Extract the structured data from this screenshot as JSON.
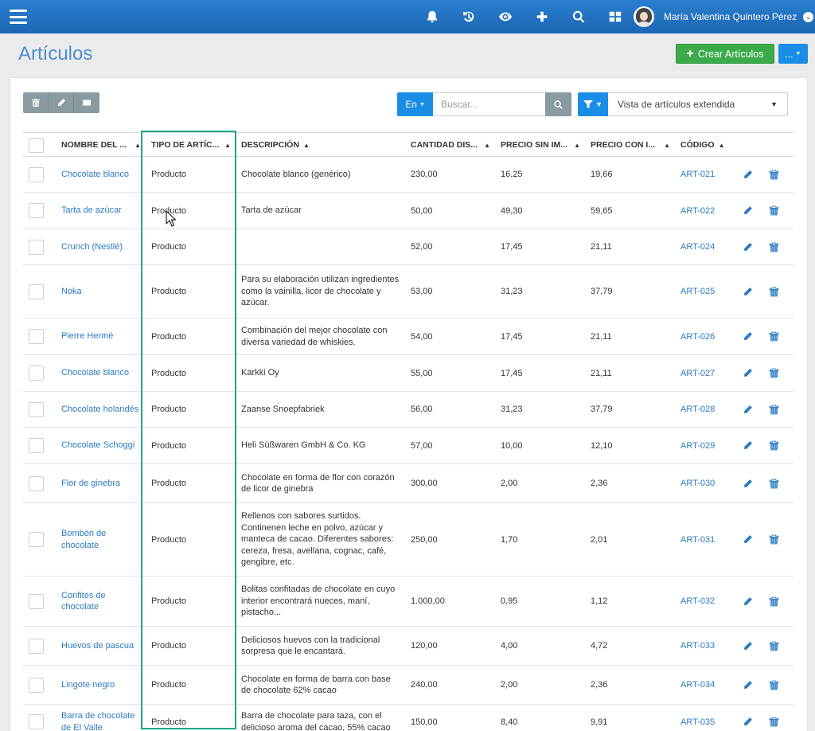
{
  "topbar": {
    "icons": [
      "bell-icon",
      "history-icon",
      "eye-icon",
      "plus-icon",
      "search-icon",
      "grid-icon"
    ],
    "user_name": "María Valentina Quintero Pérez"
  },
  "page": {
    "title": "Artículos",
    "create_label": "Crear Artículos",
    "more_label": "...",
    "search_lang": "En",
    "search_placeholder": "Buscar...",
    "view_label": "Vista de artículos extendida"
  },
  "colors": {
    "topbar": "#1c66b3",
    "accent": "#1a8ee6",
    "create": "#3bab49",
    "link": "#2a7bc3",
    "highlight": "#1aa88c"
  },
  "table": {
    "headers": [
      "NOMBRE DEL ...",
      "TIPO DE ARTÍC...",
      "DESCRIPCIÓN",
      "CANTIDAD DIS...",
      "PRECIO SIN IM...",
      "PRECIO CON I...",
      "CÓDIGO"
    ],
    "rows": [
      {
        "name": "Chocolate blanco",
        "type": "Producto",
        "desc": "Chocolate blanco (genérico)",
        "qty": "230,00",
        "price": "16,25",
        "price_tax": "19,66",
        "code": "ART-021"
      },
      {
        "name": "Tarta de azúcar",
        "type": "Producto",
        "desc": "Tarta de azúcar",
        "qty": "50,00",
        "price": "49,30",
        "price_tax": "59,65",
        "code": "ART-022"
      },
      {
        "name": "Crunch (Nestlé)",
        "type": "Producto",
        "desc": "",
        "qty": "52,00",
        "price": "17,45",
        "price_tax": "21,11",
        "code": "ART-024"
      },
      {
        "name": "Noka",
        "type": "Producto",
        "desc": "Para su elaboración utilizan ingredientes como la vainilla, licor de chocolate y azúcar.",
        "qty": "53,00",
        "price": "31,23",
        "price_tax": "37,79",
        "code": "ART-025"
      },
      {
        "name": "Pierre Hermé",
        "type": "Producto",
        "desc": "Combinación del mejor chocolate con diversa variedad de whiskies.",
        "qty": "54,00",
        "price": "17,45",
        "price_tax": "21,11",
        "code": "ART-026"
      },
      {
        "name": "Chocolate blanco",
        "type": "Producto",
        "desc": "Karkki Oy",
        "qty": "55,00",
        "price": "17,45",
        "price_tax": "21,11",
        "code": "ART-027"
      },
      {
        "name": "Chocolate holandés",
        "type": "Producto",
        "desc": "Zaanse Snoepfabriek",
        "qty": "56,00",
        "price": "31,23",
        "price_tax": "37,79",
        "code": "ART-028"
      },
      {
        "name": "Chocolate Schoggi",
        "type": "Producto",
        "desc": "Heli Süßwaren GmbH & Co. KG",
        "qty": "57,00",
        "price": "10,00",
        "price_tax": "12,10",
        "code": "ART-029"
      },
      {
        "name": "Flor de ginebra",
        "type": "Producto",
        "desc": "Chocolate en forma de flor con corazón de licor de ginebra",
        "qty": "300,00",
        "price": "2,00",
        "price_tax": "2,36",
        "code": "ART-030"
      },
      {
        "name": "Bombón de chocolate",
        "type": "Producto",
        "desc": "Rellenos con sabores surtidos. Continenen leche en polvo, azúcar y manteca de cacao. Diferentes sabores: cereza, fresa, avellana, cognac, café, gengibre, etc.",
        "qty": "250,00",
        "price": "1,70",
        "price_tax": "2,01",
        "code": "ART-031"
      },
      {
        "name": "Confites de chocolate",
        "type": "Producto",
        "desc": "Bolitas confitadas de chocolate en cuyo interior encontrará nueces, maní, pistacho...",
        "qty": "1.000,00",
        "price": "0,95",
        "price_tax": "1,12",
        "code": "ART-032"
      },
      {
        "name": "Huevos de pascua",
        "type": "Producto",
        "desc": "Deliciosos huevos con la tradicional sorpresa que le encantará.",
        "qty": "120,00",
        "price": "4,00",
        "price_tax": "4,72",
        "code": "ART-033"
      },
      {
        "name": "Lingote negro",
        "type": "Producto",
        "desc": "Chocolate en forma de barra con base de chocolate 62% cacao",
        "qty": "240,00",
        "price": "2,00",
        "price_tax": "2,36",
        "code": "ART-034"
      },
      {
        "name": "Barra de chocolate de El Valle",
        "type": "Producto",
        "desc": "Barra de chocolate para taza, con el delicioso aroma del cacao, 55% cacao",
        "qty": "150,00",
        "price": "8,40",
        "price_tax": "9,91",
        "code": "ART-035"
      }
    ]
  }
}
